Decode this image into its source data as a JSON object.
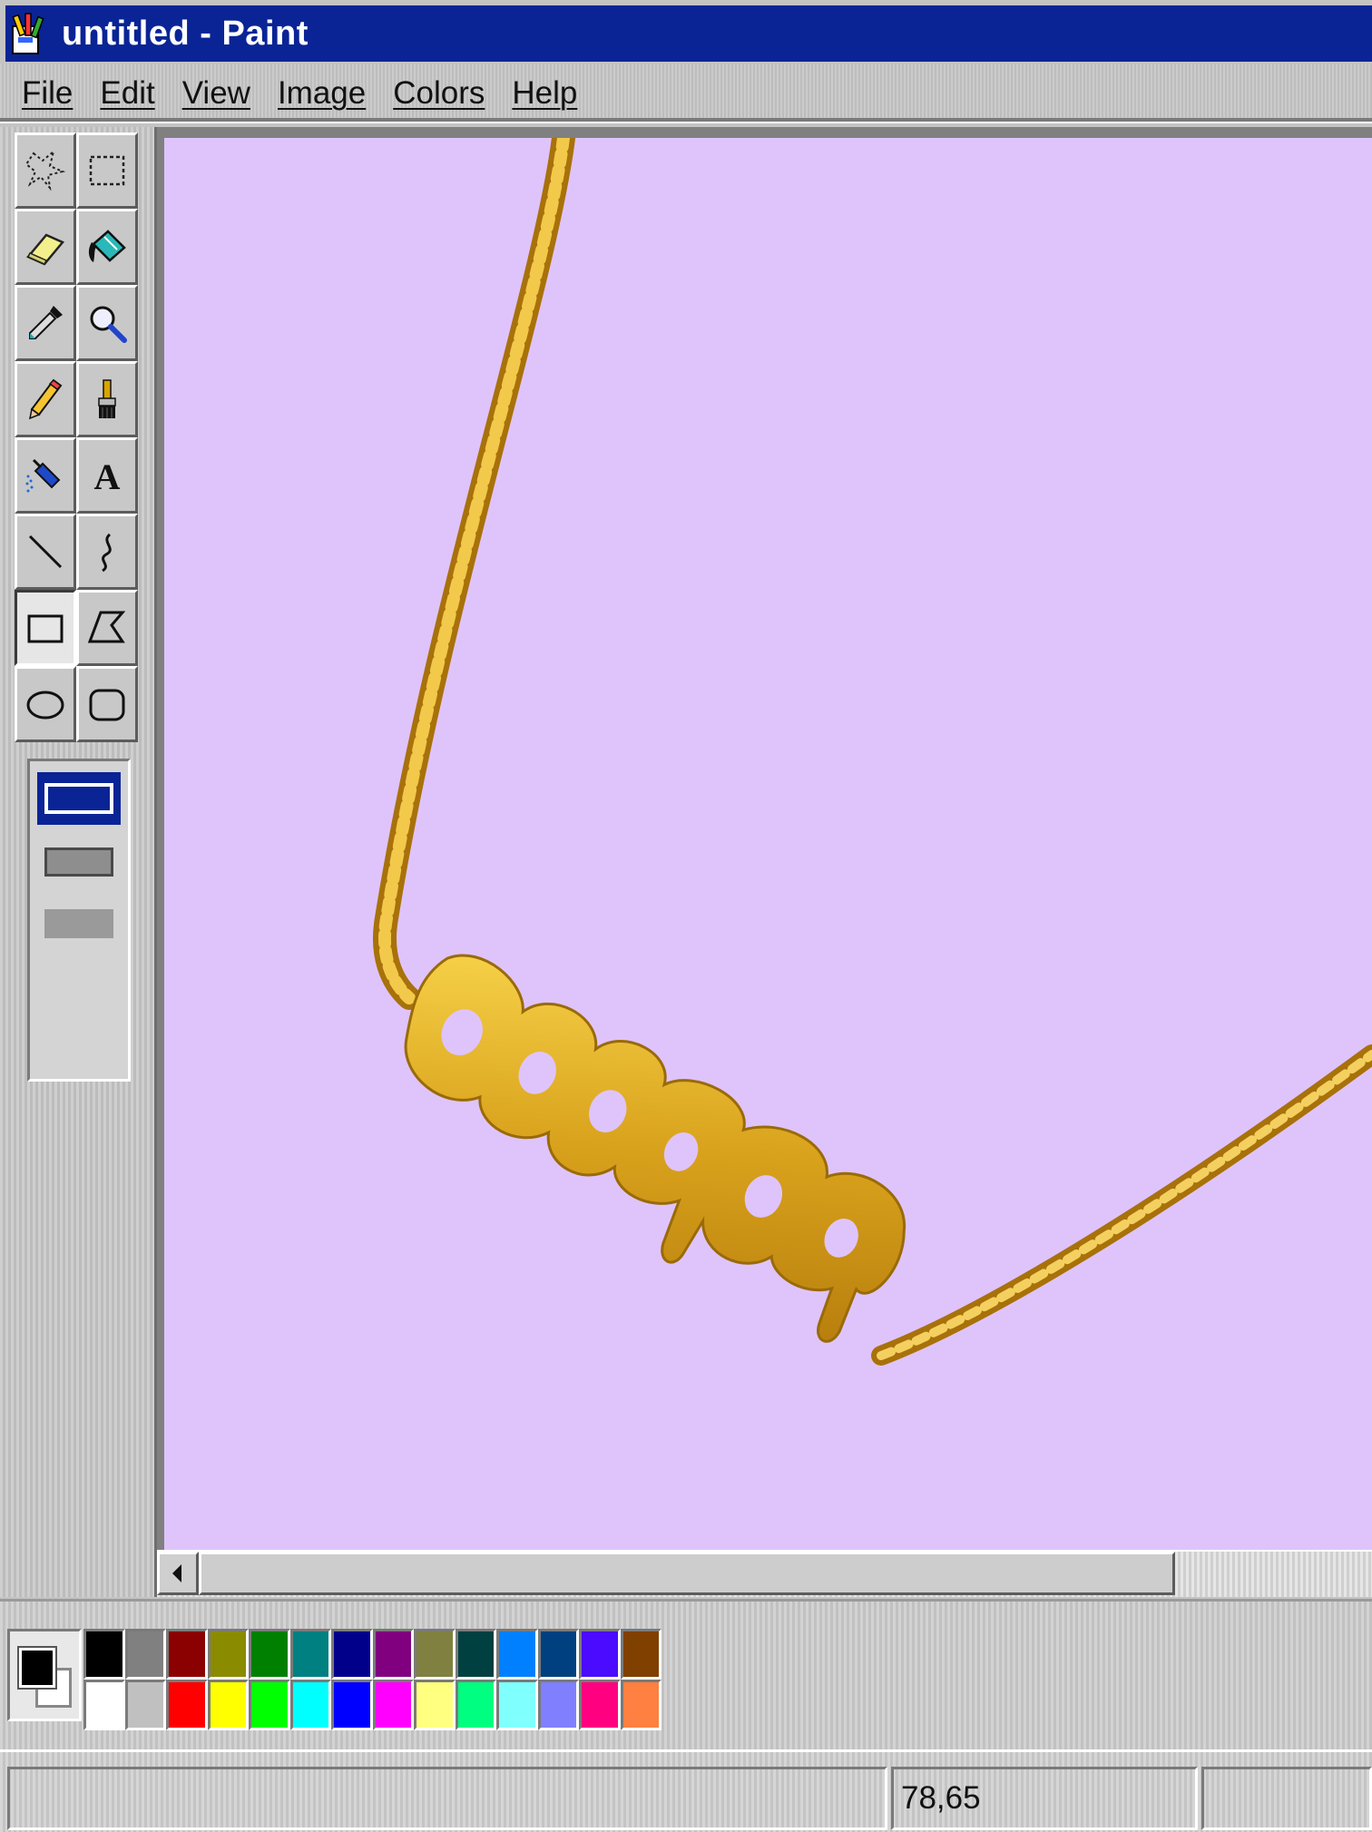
{
  "window": {
    "title": "untitled - Paint"
  },
  "menu": {
    "items": [
      "File",
      "Edit",
      "View",
      "Image",
      "Colors",
      "Help"
    ]
  },
  "toolbox": {
    "tools": [
      {
        "name": "free-form-select-icon",
        "selected": false
      },
      {
        "name": "select-icon",
        "selected": false
      },
      {
        "name": "eraser-icon",
        "selected": false
      },
      {
        "name": "fill-bucket-icon",
        "selected": false
      },
      {
        "name": "color-picker-icon",
        "selected": false
      },
      {
        "name": "magnifier-icon",
        "selected": false
      },
      {
        "name": "pencil-icon",
        "selected": false
      },
      {
        "name": "brush-icon",
        "selected": false
      },
      {
        "name": "airbrush-icon",
        "selected": false
      },
      {
        "name": "text-icon",
        "selected": false,
        "glyph": "A"
      },
      {
        "name": "line-icon",
        "selected": false
      },
      {
        "name": "curve-icon",
        "selected": false
      },
      {
        "name": "rectangle-icon",
        "selected": true
      },
      {
        "name": "polygon-icon",
        "selected": false
      },
      {
        "name": "ellipse-icon",
        "selected": false
      },
      {
        "name": "rounded-rectangle-icon",
        "selected": false
      }
    ]
  },
  "canvas": {
    "background_color": "#dfc4fb",
    "image": "gold-chain-necklace-with-name-pendant"
  },
  "palette": {
    "foreground": "#000000",
    "background": "#ffffff",
    "top_row": [
      "#000000",
      "#808080",
      "#8b0000",
      "#8b8b00",
      "#008000",
      "#008080",
      "#00008b",
      "#800080",
      "#808040",
      "#004040",
      "#0080ff",
      "#004080",
      "#4b0bff",
      "#804000"
    ],
    "bottom_row": [
      "#ffffff",
      "#c0c0c0",
      "#ff0000",
      "#ffff00",
      "#00ff00",
      "#00ffff",
      "#0000ff",
      "#ff00ff",
      "#ffff80",
      "#00ff80",
      "#80ffff",
      "#8080ff",
      "#ff0080",
      "#ff8040"
    ]
  },
  "status": {
    "coordinates": "78,65"
  }
}
